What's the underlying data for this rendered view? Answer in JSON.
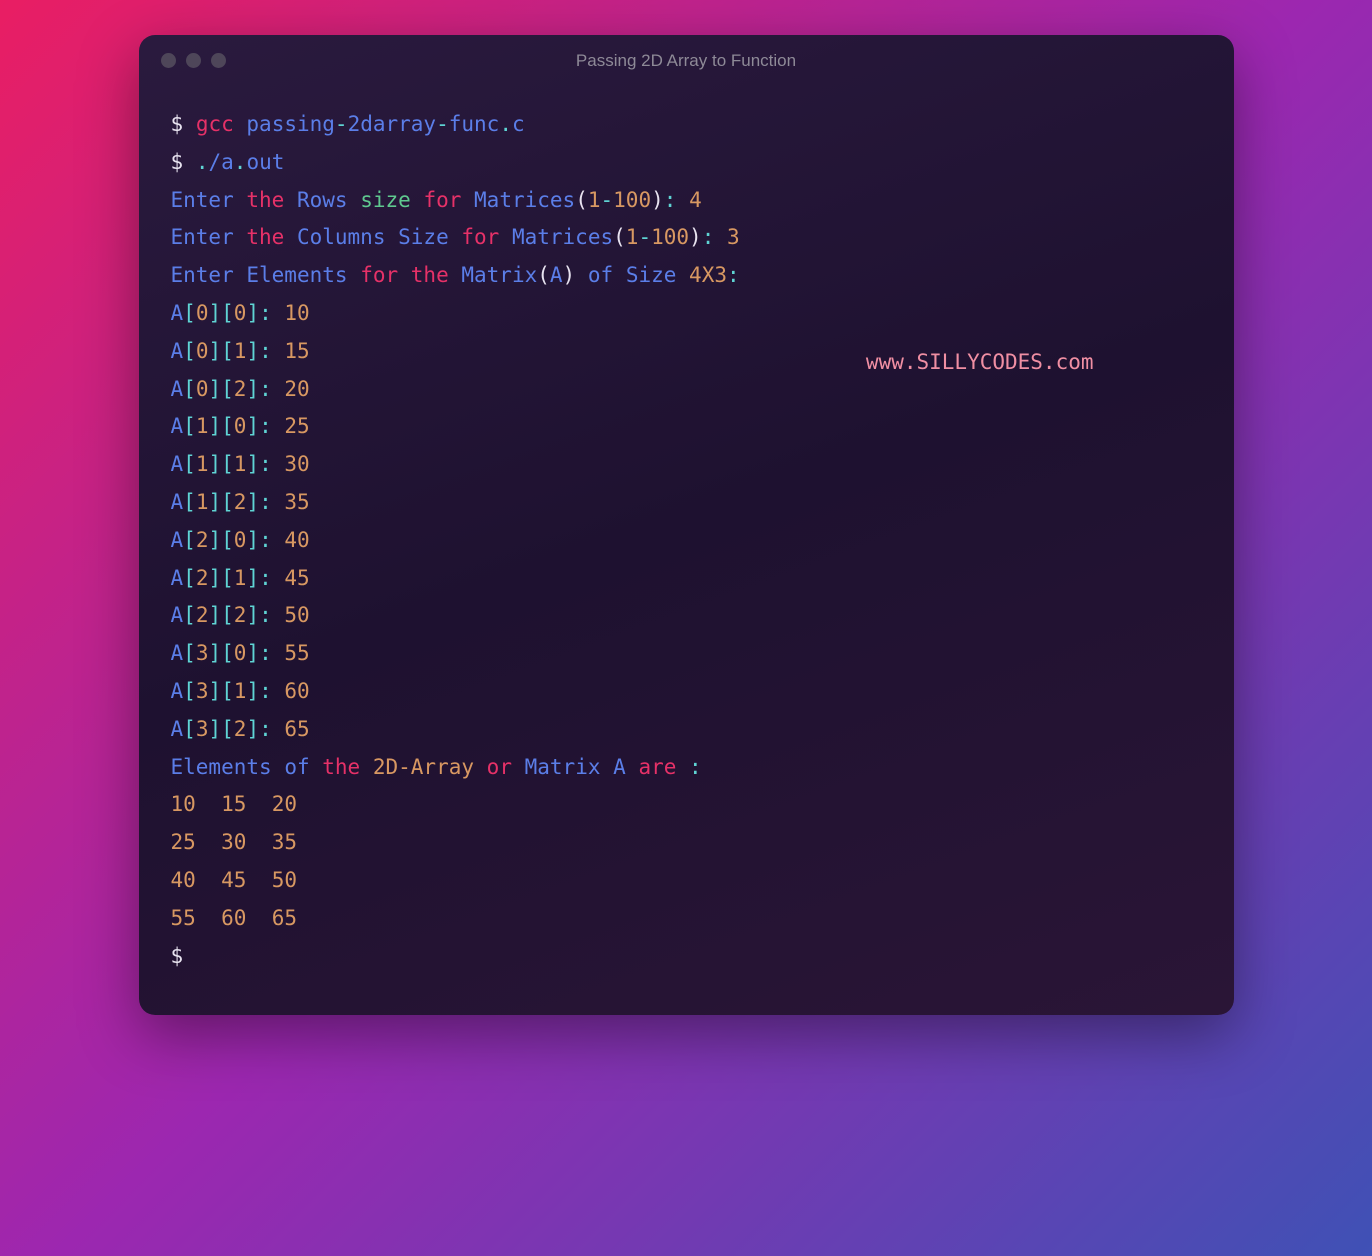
{
  "title": "Passing 2D Array to Function",
  "watermark": "www.SILLYCODES.com",
  "prompt": "$",
  "cmd1": {
    "gcc": "gcc",
    "p1": "passing",
    "dash1": "-",
    "p2": "2darray",
    "dash2": "-",
    "p3": "func",
    "dot": ".",
    "ext": "c"
  },
  "cmd2": {
    "dot1": ".",
    "slash": "/",
    "a": "a",
    "dot2": ".",
    "out": "out"
  },
  "prompt1": {
    "enter": "Enter",
    "the": "the",
    "rows": "Rows",
    "size": "size",
    "for": "for",
    "matrices": "Matrices",
    "lp": "(",
    "n1": "1",
    "dash": "-",
    "n2": "100",
    "rp": ")",
    "colon": ":",
    "val": "4"
  },
  "prompt2": {
    "enter": "Enter",
    "the": "the",
    "cols": "Columns",
    "size": "Size",
    "for": "for",
    "matrices": "Matrices",
    "lp": "(",
    "n1": "1",
    "dash": "-",
    "n2": "100",
    "rp": ")",
    "colon": ":",
    "val": "3"
  },
  "prompt3": {
    "enter": "Enter",
    "elements": "Elements",
    "for": "for",
    "the": "the",
    "matrix": "Matrix",
    "lp": "(",
    "a": "A",
    "rp": ")",
    "of": "of",
    "size": "Size",
    "dim": "4X3",
    "colon": ":"
  },
  "entries": [
    {
      "r": "0",
      "c": "0",
      "v": "10"
    },
    {
      "r": "0",
      "c": "1",
      "v": "15"
    },
    {
      "r": "0",
      "c": "2",
      "v": "20"
    },
    {
      "r": "1",
      "c": "0",
      "v": "25"
    },
    {
      "r": "1",
      "c": "1",
      "v": "30"
    },
    {
      "r": "1",
      "c": "2",
      "v": "35"
    },
    {
      "r": "2",
      "c": "0",
      "v": "40"
    },
    {
      "r": "2",
      "c": "1",
      "v": "45"
    },
    {
      "r": "2",
      "c": "2",
      "v": "50"
    },
    {
      "r": "3",
      "c": "0",
      "v": "55"
    },
    {
      "r": "3",
      "c": "1",
      "v": "60"
    },
    {
      "r": "3",
      "c": "2",
      "v": "65"
    }
  ],
  "entrylabels": {
    "a": "A",
    "lb": "[",
    "rb": "]",
    "colon": ":"
  },
  "output_header": {
    "elements": "Elements",
    "of": "of",
    "the": "the",
    "arr": "2D-Array",
    "or": "or",
    "matrix": "Matrix",
    "a": "A",
    "are": "are",
    "colon": ":"
  },
  "matrix": [
    [
      "10",
      "15",
      "20"
    ],
    [
      "25",
      "30",
      "35"
    ],
    [
      "40",
      "45",
      "50"
    ],
    [
      "55",
      "60",
      "65"
    ]
  ]
}
